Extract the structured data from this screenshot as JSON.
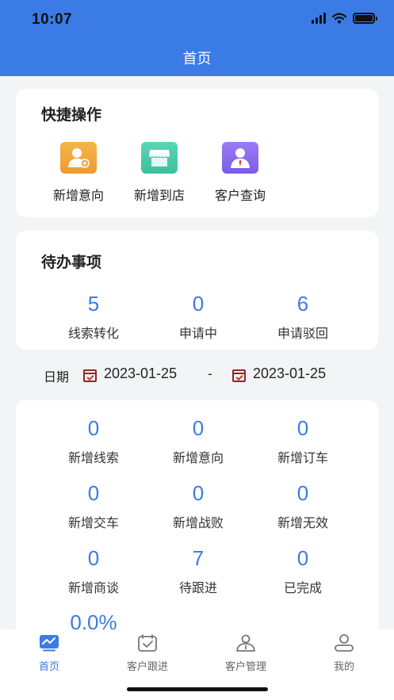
{
  "status_bar": {
    "time": "10:07"
  },
  "header": {
    "title": "首页"
  },
  "quick_actions": {
    "title": "快捷操作",
    "items": [
      {
        "label": "新增意向",
        "icon": "add-user-icon",
        "color": "#f0a13b"
      },
      {
        "label": "新增到店",
        "icon": "store-icon",
        "color": "#46c9a8"
      },
      {
        "label": "客户查询",
        "icon": "customer-search-icon",
        "color": "#8a6cf0"
      }
    ]
  },
  "todo": {
    "title": "待办事项",
    "items": [
      {
        "value": "5",
        "label": "线索转化"
      },
      {
        "value": "0",
        "label": "申请中"
      },
      {
        "value": "6",
        "label": "申请驳回"
      }
    ]
  },
  "date_filter": {
    "label": "日期",
    "start": "2023-01-25",
    "separator": "-",
    "end": "2023-01-25"
  },
  "stats": {
    "items": [
      {
        "value": "0",
        "label": "新增线索"
      },
      {
        "value": "0",
        "label": "新增意向"
      },
      {
        "value": "0",
        "label": "新增订车"
      },
      {
        "value": "0",
        "label": "新增交车"
      },
      {
        "value": "0",
        "label": "新增战败"
      },
      {
        "value": "0",
        "label": "新增无效"
      },
      {
        "value": "0",
        "label": "新增商谈"
      },
      {
        "value": "7",
        "label": "待跟进"
      },
      {
        "value": "0",
        "label": "已完成"
      }
    ],
    "percent": "0.0%"
  },
  "tabbar": {
    "items": [
      {
        "label": "首页",
        "icon": "home-chart-icon",
        "active": true
      },
      {
        "label": "客户跟进",
        "icon": "calendar-check-icon",
        "active": false
      },
      {
        "label": "客户管理",
        "icon": "customer-manage-icon",
        "active": false
      },
      {
        "label": "我的",
        "icon": "profile-icon",
        "active": false
      }
    ]
  },
  "colors": {
    "accent": "#3b7be6",
    "background": "#f3f4f6"
  }
}
